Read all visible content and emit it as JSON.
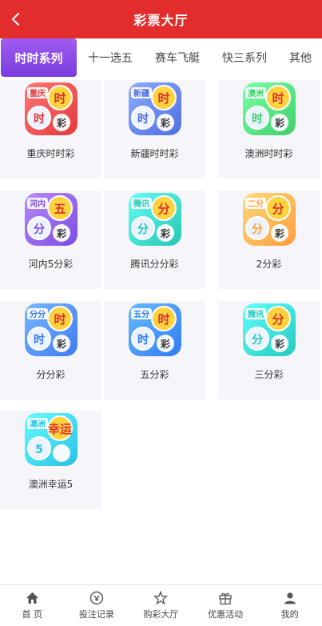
{
  "header": {
    "title": "彩票大厅",
    "back_icon": "chevron-left-icon"
  },
  "tabs": [
    {
      "label": "时时系列",
      "active": true
    },
    {
      "label": "十一选五",
      "active": false
    },
    {
      "label": "赛车飞艇",
      "active": false
    },
    {
      "label": "快三系列",
      "active": false
    },
    {
      "label": "其他",
      "active": false
    }
  ],
  "games": [
    {
      "label": "重庆时时彩",
      "badge": "重庆",
      "chars": [
        "时",
        "时",
        "彩"
      ],
      "bg": "#e23a3a"
    },
    {
      "label": "新疆时时彩",
      "badge": "新疆",
      "chars": [
        "时",
        "时",
        "彩"
      ],
      "bg": "#4f6fe0"
    },
    {
      "label": "澳洲时时彩",
      "badge": "澳洲",
      "chars": [
        "时",
        "时",
        "彩"
      ],
      "bg": "#3fcf6a"
    },
    {
      "label": "河内5分彩",
      "badge": "河内",
      "chars": [
        "五",
        "分",
        "彩"
      ],
      "bg": "#7b4de0"
    },
    {
      "label": "腾讯分分彩",
      "badge": "腾讯",
      "chars": [
        "分",
        "分",
        "彩"
      ],
      "bg": "#26c6b6"
    },
    {
      "label": "2分彩",
      "badge": "二分",
      "chars": [
        "分",
        "分",
        "彩"
      ],
      "bg": "#ff9d3d"
    },
    {
      "label": "分分彩",
      "badge": "分分",
      "chars": [
        "时",
        "时",
        "彩"
      ],
      "bg": "#3d7bf0"
    },
    {
      "label": "五分彩",
      "badge": "五分",
      "chars": [
        "时",
        "时",
        "彩"
      ],
      "bg": "#2f7df0"
    },
    {
      "label": "三分彩",
      "badge": "腾讯",
      "chars": [
        "分",
        "分",
        "彩"
      ],
      "bg": "#24c9c0"
    },
    {
      "label": "澳洲幸运5",
      "badge": "澳洲",
      "chars": [
        "幸运",
        "5",
        ""
      ],
      "bg": "#2bc0e6"
    }
  ],
  "bottom_nav": [
    {
      "label": "首 页",
      "icon": "home-icon"
    },
    {
      "label": "投注记录",
      "icon": "bet-record-icon"
    },
    {
      "label": "购彩大厅",
      "icon": "lottery-hall-icon"
    },
    {
      "label": "优惠活动",
      "icon": "gift-icon"
    },
    {
      "label": "我的",
      "icon": "user-icon"
    }
  ]
}
